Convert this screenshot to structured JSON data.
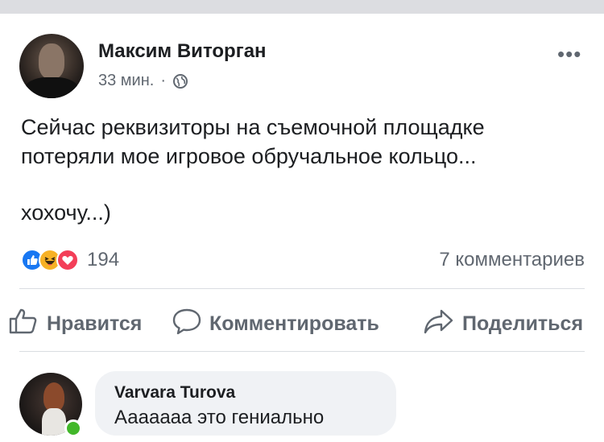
{
  "post": {
    "author": "Максим Виторган",
    "time": "33 мин.",
    "separator": "·",
    "privacy_icon": "globe-icon",
    "more_icon": "more-options-icon",
    "more_label": "•••",
    "text_line1": "Сейчас реквизиторы на съемочной площадке",
    "text_line2": "потеряли мое игровое обручальное кольцо...",
    "text_line3": "хохочу...)"
  },
  "reactions": {
    "icons": [
      "like-icon",
      "haha-icon",
      "love-icon"
    ],
    "count": "194",
    "comments": "7 комментариев"
  },
  "actions": {
    "like": "Нравится",
    "comment": "Комментировать",
    "share": "Поделиться"
  },
  "comment": {
    "author": "Varvara Turova",
    "text": "Ааааааа это гениально",
    "online": true
  },
  "colors": {
    "accent": "#1877f2",
    "haha": "#f7b125",
    "love": "#f33e58",
    "online": "#42b72a",
    "muted_text": "#606770",
    "bubble": "#f0f2f5"
  }
}
